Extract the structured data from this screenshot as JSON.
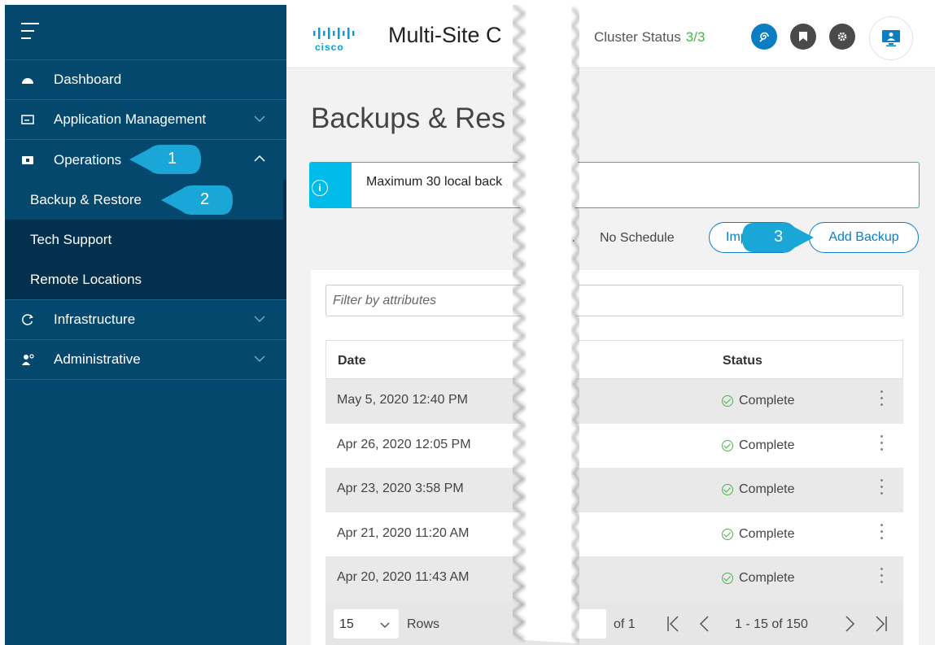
{
  "sidebar": {
    "items": [
      {
        "label": "Dashboard",
        "icon": "dashboard-icon"
      },
      {
        "label": "Application Management",
        "icon": "app-management-icon"
      },
      {
        "label": "Operations",
        "icon": "operations-icon"
      },
      {
        "label": "Infrastructure",
        "icon": "infrastructure-icon"
      },
      {
        "label": "Administrative",
        "icon": "administrative-icon"
      }
    ],
    "operations_sub": [
      {
        "label": "Backup & Restore"
      },
      {
        "label": "Tech Support"
      },
      {
        "label": "Remote Locations"
      }
    ]
  },
  "header": {
    "logo_text": "cisco",
    "app_title": "Multi-Site C",
    "cluster_label": "Cluster Status",
    "cluster_value": "3/3"
  },
  "main": {
    "page_title": "Backups & Res",
    "info_text": "Maximum 30 local back",
    "schedule_prefix": "\\",
    "schedule_text": "No Schedule",
    "import_label": "Impo",
    "add_backup_label": "Add Backup",
    "filter_placeholder": "Filter by attributes",
    "table": {
      "col_date": "Date",
      "col_status": "Status",
      "rows": [
        {
          "date": "May 5, 2020 12:40 PM",
          "status": "Complete"
        },
        {
          "date": "Apr 26, 2020 12:05 PM",
          "status": "Complete"
        },
        {
          "date": "Apr 23, 2020 3:58 PM",
          "status": "Complete"
        },
        {
          "date": "Apr 21, 2020 11:20 AM",
          "status": "Complete"
        },
        {
          "date": "Apr 20, 2020 11:43 AM",
          "status": "Complete"
        }
      ]
    },
    "pager": {
      "rows_value": "15",
      "rows_label": "Rows",
      "of_label": "of 1",
      "range": "1 - 15 of 150"
    }
  },
  "callouts": [
    "1",
    "2",
    "3"
  ],
  "colors": {
    "sidebar_bg": "#04486e",
    "sidebar_sub_bg": "#03314d",
    "accent": "#0b7ec2",
    "info": "#00bceb",
    "callout": "#1aa7d8",
    "success": "#4bb34b"
  }
}
